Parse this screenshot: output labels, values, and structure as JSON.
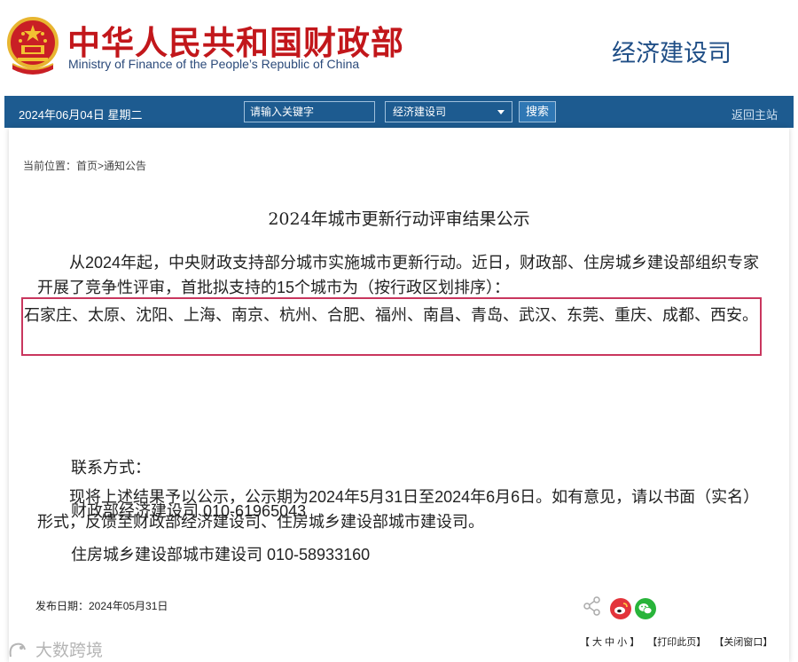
{
  "header": {
    "site_name_cn": "中华人民共和国财政部",
    "site_name_en": "Ministry of Finance of the People’s Republic of China",
    "department": "经济建设司",
    "brand_color": "#c2171b"
  },
  "navbar": {
    "date": "2024年06月04日  星期二",
    "search_placeholder": "请输入关键字",
    "scope_selected": "经济建设司",
    "search_button": "搜索",
    "back_link": "返回主站",
    "bar_color": "#1d5b90"
  },
  "breadcrumb": "当前位置：首页>通知公告",
  "article": {
    "title": "2024年城市更新行动评审结果公示",
    "para1": "从2024年起，中央财政支持部分城市实施城市更新行动。近日，财政部、住房城乡建设部组织专家开展了竞争性评审，首批拟支持的15个城市为（按行政区划排序）：",
    "cities": "石家庄、太原、沈阳、上海、南京、杭州、合肥、福州、南昌、青岛、武汉、东莞、重庆、成都、西安。",
    "para2": "现将上述结果予以公示，公示期为2024年5月31日至2024年6月6日。如有意见，请以书面（实名）形式，反馈至财政部经济建设司、住房城乡建设部城市建设司。",
    "contact_label": "联系方式：",
    "contact_1": "财政部经济建设司 010-61965043",
    "contact_2": "住房城乡建设部城市建设司 010-58933160",
    "highlight_color": "#c9365e"
  },
  "footer": {
    "publish_date": "发布日期：2024年05月31日",
    "font_size_label": "【 大 中 小 】",
    "print_label": "【打印此页】",
    "close_label": "【关闭窗口】",
    "share_icons": [
      "share-icon",
      "weibo-icon",
      "wechat-icon"
    ]
  },
  "watermark": "大数跨境"
}
